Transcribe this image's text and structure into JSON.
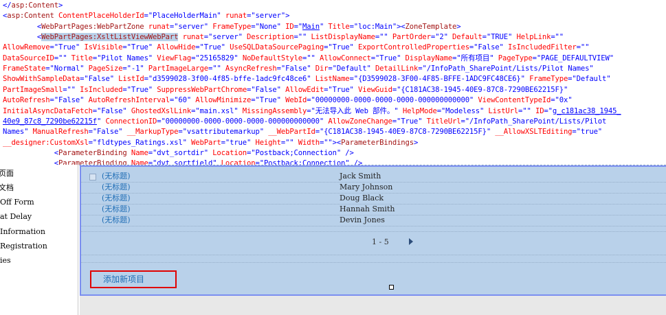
{
  "code": {
    "lines": [
      [
        {
          "c": "t",
          "s": "</"
        },
        {
          "c": "tn",
          "s": "asp:Content"
        },
        {
          "c": "t",
          "s": ">"
        }
      ],
      [
        {
          "c": "t",
          "s": "<"
        },
        {
          "c": "tn",
          "s": "asp:Content"
        },
        {
          "c": "an",
          "s": " ContentPlaceHolderId"
        },
        {
          "c": "t",
          "s": "="
        },
        {
          "c": "av",
          "s": "\"PlaceHolderMain\""
        },
        {
          "c": "an",
          "s": " runat"
        },
        {
          "c": "t",
          "s": "="
        },
        {
          "c": "av",
          "s": "\"server\""
        },
        {
          "c": "t",
          "s": ">"
        }
      ],
      [
        {
          "c": "t",
          "s": "        <"
        },
        {
          "c": "tn",
          "s": "WebPartPages:WebPartZone"
        },
        {
          "c": "an",
          "s": " runat"
        },
        {
          "c": "t",
          "s": "="
        },
        {
          "c": "av",
          "s": "\"server\""
        },
        {
          "c": "an",
          "s": " FrameType"
        },
        {
          "c": "t",
          "s": "="
        },
        {
          "c": "av",
          "s": "\"None\""
        },
        {
          "c": "an",
          "s": " ID"
        },
        {
          "c": "t",
          "s": "="
        },
        {
          "c": "av",
          "s": "\""
        },
        {
          "c": "av ul",
          "s": "Main"
        },
        {
          "c": "av",
          "s": "\""
        },
        {
          "c": "an",
          "s": " Title"
        },
        {
          "c": "t",
          "s": "="
        },
        {
          "c": "av",
          "s": "\"loc:Main\""
        },
        {
          "c": "t",
          "s": "><"
        },
        {
          "c": "tn",
          "s": "ZoneTemplate"
        },
        {
          "c": "t",
          "s": ">"
        }
      ],
      [
        {
          "c": "t",
          "s": "        <"
        },
        {
          "c": "tn sel",
          "s": "WebPartPages:XsltListViewWebPart"
        },
        {
          "c": "an",
          "s": " runat"
        },
        {
          "c": "t",
          "s": "="
        },
        {
          "c": "av",
          "s": "\"server\""
        },
        {
          "c": "an",
          "s": " Description"
        },
        {
          "c": "t",
          "s": "="
        },
        {
          "c": "av",
          "s": "\"\""
        },
        {
          "c": "an",
          "s": " ListDisplayName"
        },
        {
          "c": "t",
          "s": "="
        },
        {
          "c": "av",
          "s": "\"\""
        },
        {
          "c": "an",
          "s": " PartOrder"
        },
        {
          "c": "t",
          "s": "="
        },
        {
          "c": "av",
          "s": "\"2\""
        },
        {
          "c": "an",
          "s": " Default"
        },
        {
          "c": "t",
          "s": "="
        },
        {
          "c": "av",
          "s": "\"TRUE\""
        },
        {
          "c": "an",
          "s": " HelpLink"
        },
        {
          "c": "t",
          "s": "=\"\""
        }
      ],
      [
        {
          "c": "an",
          "s": "AllowRemove"
        },
        {
          "c": "t",
          "s": "="
        },
        {
          "c": "av",
          "s": "\"True\""
        },
        {
          "c": "an",
          "s": " IsVisible"
        },
        {
          "c": "t",
          "s": "="
        },
        {
          "c": "av",
          "s": "\"True\""
        },
        {
          "c": "an",
          "s": " AllowHide"
        },
        {
          "c": "t",
          "s": "="
        },
        {
          "c": "av",
          "s": "\"True\""
        },
        {
          "c": "an",
          "s": " UseSQLDataSourcePaging"
        },
        {
          "c": "t",
          "s": "="
        },
        {
          "c": "av",
          "s": "\"True\""
        },
        {
          "c": "an",
          "s": " ExportControlledProperties"
        },
        {
          "c": "t",
          "s": "="
        },
        {
          "c": "av",
          "s": "\"False\""
        },
        {
          "c": "an",
          "s": " IsIncludedFilter"
        },
        {
          "c": "t",
          "s": "=\"\""
        }
      ],
      [
        {
          "c": "an",
          "s": "DataSourceID"
        },
        {
          "c": "t",
          "s": "="
        },
        {
          "c": "av",
          "s": "\"\""
        },
        {
          "c": "an",
          "s": " Title"
        },
        {
          "c": "t",
          "s": "="
        },
        {
          "c": "av",
          "s": "\"Pilot Names\""
        },
        {
          "c": "an",
          "s": " ViewFlag"
        },
        {
          "c": "t",
          "s": "="
        },
        {
          "c": "av",
          "s": "\"25165829\""
        },
        {
          "c": "an",
          "s": " NoDefaultStyle"
        },
        {
          "c": "t",
          "s": "="
        },
        {
          "c": "av",
          "s": "\"\""
        },
        {
          "c": "an",
          "s": " AllowConnect"
        },
        {
          "c": "t",
          "s": "="
        },
        {
          "c": "av",
          "s": "\"True\""
        },
        {
          "c": "an",
          "s": " DisplayName"
        },
        {
          "c": "t",
          "s": "="
        },
        {
          "c": "av",
          "s": "\"所有项目\""
        },
        {
          "c": "an",
          "s": " PageType"
        },
        {
          "c": "t",
          "s": "="
        },
        {
          "c": "av",
          "s": "\"PAGE_DEFAULTVIEW\""
        }
      ],
      [
        {
          "c": "an",
          "s": "FrameState"
        },
        {
          "c": "t",
          "s": "="
        },
        {
          "c": "av",
          "s": "\"Normal\""
        },
        {
          "c": "an",
          "s": " PageSize"
        },
        {
          "c": "t",
          "s": "="
        },
        {
          "c": "av",
          "s": "\"-1\""
        },
        {
          "c": "an",
          "s": " PartImageLarge"
        },
        {
          "c": "t",
          "s": "="
        },
        {
          "c": "av",
          "s": "\"\""
        },
        {
          "c": "an",
          "s": " AsyncRefresh"
        },
        {
          "c": "t",
          "s": "="
        },
        {
          "c": "av",
          "s": "\"False\""
        },
        {
          "c": "an",
          "s": " Dir"
        },
        {
          "c": "t",
          "s": "="
        },
        {
          "c": "av",
          "s": "\"Default\""
        },
        {
          "c": "an",
          "s": " DetailLink"
        },
        {
          "c": "t",
          "s": "="
        },
        {
          "c": "av",
          "s": "\"/InfoPath_SharePoint/Lists/Pilot Names\""
        }
      ],
      [
        {
          "c": "an",
          "s": "ShowWithSampleData"
        },
        {
          "c": "t",
          "s": "="
        },
        {
          "c": "av",
          "s": "\"False\""
        },
        {
          "c": "an",
          "s": " ListId"
        },
        {
          "c": "t",
          "s": "="
        },
        {
          "c": "av",
          "s": "\"d3599028-3f00-4f85-bffe-1adc9fc48ce6\""
        },
        {
          "c": "an",
          "s": " ListName"
        },
        {
          "c": "t",
          "s": "="
        },
        {
          "c": "av",
          "s": "\"{D3599028-3F00-4F85-BFFE-1ADC9FC48CE6}\""
        },
        {
          "c": "an",
          "s": " FrameType"
        },
        {
          "c": "t",
          "s": "="
        },
        {
          "c": "av",
          "s": "\"Default\""
        }
      ],
      [
        {
          "c": "an",
          "s": "PartImageSmall"
        },
        {
          "c": "t",
          "s": "="
        },
        {
          "c": "av",
          "s": "\"\""
        },
        {
          "c": "an",
          "s": " IsIncluded"
        },
        {
          "c": "t",
          "s": "="
        },
        {
          "c": "av",
          "s": "\"True\""
        },
        {
          "c": "an",
          "s": " SuppressWebPartChrome"
        },
        {
          "c": "t",
          "s": "="
        },
        {
          "c": "av",
          "s": "\"False\""
        },
        {
          "c": "an",
          "s": " AllowEdit"
        },
        {
          "c": "t",
          "s": "="
        },
        {
          "c": "av",
          "s": "\"True\""
        },
        {
          "c": "an",
          "s": " ViewGuid"
        },
        {
          "c": "t",
          "s": "="
        },
        {
          "c": "av",
          "s": "\"{C181AC38-1945-40E9-87C8-7290BE62215F}\""
        }
      ],
      [
        {
          "c": "an",
          "s": "AutoRefresh"
        },
        {
          "c": "t",
          "s": "="
        },
        {
          "c": "av",
          "s": "\"False\""
        },
        {
          "c": "an",
          "s": " AutoRefreshInterval"
        },
        {
          "c": "t",
          "s": "="
        },
        {
          "c": "av",
          "s": "\"60\""
        },
        {
          "c": "an",
          "s": " AllowMinimize"
        },
        {
          "c": "t",
          "s": "="
        },
        {
          "c": "av",
          "s": "\"True\""
        },
        {
          "c": "an",
          "s": " WebId"
        },
        {
          "c": "t",
          "s": "="
        },
        {
          "c": "av",
          "s": "\"00000000-0000-0000-0000-000000000000\""
        },
        {
          "c": "an",
          "s": " ViewContentTypeId"
        },
        {
          "c": "t",
          "s": "="
        },
        {
          "c": "av",
          "s": "\"0x\""
        }
      ],
      [
        {
          "c": "an",
          "s": "InitialAsyncDataFetch"
        },
        {
          "c": "t",
          "s": "="
        },
        {
          "c": "av",
          "s": "\"False\""
        },
        {
          "c": "an",
          "s": " GhostedXslLink"
        },
        {
          "c": "t",
          "s": "="
        },
        {
          "c": "av",
          "s": "\"main.xsl\""
        },
        {
          "c": "an",
          "s": " MissingAssembly"
        },
        {
          "c": "t",
          "s": "="
        },
        {
          "c": "av",
          "s": "\"无法导入此 Web 部件。\""
        },
        {
          "c": "an",
          "s": " HelpMode"
        },
        {
          "c": "t",
          "s": "="
        },
        {
          "c": "av",
          "s": "\"Modeless\""
        },
        {
          "c": "an",
          "s": " ListUrl"
        },
        {
          "c": "t",
          "s": "="
        },
        {
          "c": "av",
          "s": "\"\""
        },
        {
          "c": "an",
          "s": " ID"
        },
        {
          "c": "t",
          "s": "="
        },
        {
          "c": "av",
          "s": "\""
        },
        {
          "c": "av ul",
          "s": "g_c181ac38_1945_"
        }
      ],
      [
        {
          "c": "av ul",
          "s": "40e9_87c8_7290be62215f"
        },
        {
          "c": "av",
          "s": "\""
        },
        {
          "c": "an",
          "s": " ConnectionID"
        },
        {
          "c": "t",
          "s": "="
        },
        {
          "c": "av",
          "s": "\"00000000-0000-0000-0000-000000000000\""
        },
        {
          "c": "an",
          "s": " AllowZoneChange"
        },
        {
          "c": "t",
          "s": "="
        },
        {
          "c": "av",
          "s": "\"True\""
        },
        {
          "c": "an",
          "s": " TitleUrl"
        },
        {
          "c": "t",
          "s": "="
        },
        {
          "c": "av",
          "s": "\"/InfoPath_SharePoint/Lists/Pilot"
        }
      ],
      [
        {
          "c": "av",
          "s": "Names\""
        },
        {
          "c": "an",
          "s": " ManualRefresh"
        },
        {
          "c": "t",
          "s": "="
        },
        {
          "c": "av",
          "s": "\"False\""
        },
        {
          "c": "an",
          "s": " __MarkupType"
        },
        {
          "c": "t",
          "s": "="
        },
        {
          "c": "av",
          "s": "\"vsattributemarkup\""
        },
        {
          "c": "an",
          "s": " __WebPartId"
        },
        {
          "c": "t",
          "s": "="
        },
        {
          "c": "av",
          "s": "\"{C181AC38-1945-40E9-87C8-7290BE62215F}\""
        },
        {
          "c": "an",
          "s": " __AllowXSLTEditing"
        },
        {
          "c": "t",
          "s": "="
        },
        {
          "c": "av",
          "s": "\"true\""
        }
      ],
      [
        {
          "c": "an",
          "s": "__designer:CustomXsl"
        },
        {
          "c": "t",
          "s": "="
        },
        {
          "c": "av",
          "s": "\"fldtypes_Ratings.xsl\""
        },
        {
          "c": "an",
          "s": " WebPart"
        },
        {
          "c": "t",
          "s": "="
        },
        {
          "c": "av",
          "s": "\"true\""
        },
        {
          "c": "an",
          "s": " Height"
        },
        {
          "c": "t",
          "s": "="
        },
        {
          "c": "av",
          "s": "\"\""
        },
        {
          "c": "an",
          "s": " Width"
        },
        {
          "c": "t",
          "s": "="
        },
        {
          "c": "av",
          "s": "\"\""
        },
        {
          "c": "t",
          "s": "><"
        },
        {
          "c": "tn",
          "s": "ParameterBindings"
        },
        {
          "c": "t",
          "s": ">"
        }
      ],
      [
        {
          "c": "t",
          "s": "            <"
        },
        {
          "c": "tn",
          "s": "ParameterBinding"
        },
        {
          "c": "an",
          "s": " Name"
        },
        {
          "c": "t",
          "s": "="
        },
        {
          "c": "av",
          "s": "\"dvt_sortdir\""
        },
        {
          "c": "an",
          "s": " Location"
        },
        {
          "c": "t",
          "s": "="
        },
        {
          "c": "av",
          "s": "\"Postback;Connection\""
        },
        {
          "c": "t",
          "s": " />"
        }
      ],
      [
        {
          "c": "t",
          "s": "            <"
        },
        {
          "c": "tn",
          "s": "ParameterBinding"
        },
        {
          "c": "an",
          "s": " Name"
        },
        {
          "c": "t",
          "s": "="
        },
        {
          "c": "av",
          "s": "\"dvt_sortfield\""
        },
        {
          "c": "an",
          "s": " Location"
        },
        {
          "c": "t",
          "s": "="
        },
        {
          "c": "av",
          "s": "\"Postback;Connection\""
        },
        {
          "c": "t",
          "s": " />"
        }
      ]
    ]
  },
  "nav": {
    "items": [
      "页面",
      "文档",
      "Off Form",
      "at Delay",
      "Information",
      "Registration",
      "ies",
      ""
    ]
  },
  "list": {
    "rows": [
      {
        "title": "(无标题)",
        "name": "Jack Smith"
      },
      {
        "title": "(无标题)",
        "name": "Mary Johnson"
      },
      {
        "title": "(无标题)",
        "name": "Doug Black"
      },
      {
        "title": "(无标题)",
        "name": "Hannah Smith"
      },
      {
        "title": "(无标题)",
        "name": "Devin Jones"
      }
    ],
    "pager": "1 - 5",
    "add_item_label": "添加新项目"
  },
  "colors": {
    "webpart_bg": "#b9d1ea",
    "webpart_border": "#7b8ef0",
    "highlight_border": "#e00000",
    "link": "#1f6db5"
  },
  "icons": {
    "pager_next": "triangle-right"
  }
}
